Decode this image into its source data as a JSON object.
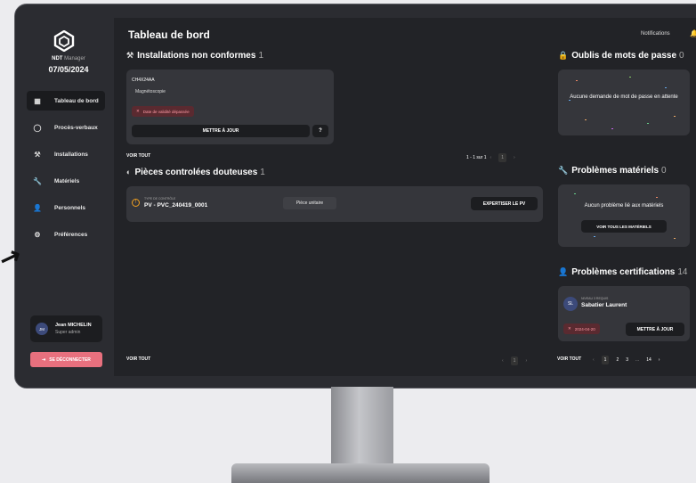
{
  "app": {
    "name_bold": "NDT",
    "name_rest": " Manager",
    "date": "07/05/2024"
  },
  "sidebar": {
    "items": [
      {
        "label": "Tableau de bord",
        "icon": "dashboard-icon"
      },
      {
        "label": "Procès-verbaux",
        "icon": "circle-icon"
      },
      {
        "label": "Installations",
        "icon": "installation-icon"
      },
      {
        "label": "Matériels",
        "icon": "wrench-icon"
      },
      {
        "label": "Personnels",
        "icon": "person-icon"
      },
      {
        "label": "Préférences",
        "icon": "gear-icon"
      }
    ],
    "user": {
      "initials": "JM",
      "name": "Jean MICHELIN",
      "role": "Super admin"
    },
    "logout": "SE DÉCONNECTER"
  },
  "header": {
    "title": "Tableau de bord",
    "notifications": "Notifications"
  },
  "installations": {
    "title": "Installations non conformes",
    "count": "1",
    "card": {
      "id": "CH4X24AA",
      "method": "Magnétoscopie",
      "alert": "Date de validité dépassée",
      "button": "METTRE À JOUR"
    },
    "see_all": "VOIR TOUT",
    "pagination": "1 - 1 sur 1",
    "page": "1"
  },
  "pieces": {
    "title": "Pièces controlées douteuses",
    "count": "1",
    "card": {
      "type_label": "TYPE DE CONTRÔLE",
      "name": "PV - PVC_240419_0001",
      "tag": "Pièce unitaire",
      "button": "EXPERTISER LE PV"
    },
    "see_all": "VOIR TOUT",
    "page": "1"
  },
  "passwords": {
    "title": "Oublis de mots de passe",
    "count": "0",
    "empty": "Aucune demande de mot de passe en attente"
  },
  "materials": {
    "title": "Problèmes matériels",
    "count": "0",
    "empty": "Aucun problème lié aux matériels",
    "button": "VOIR TOUS LES MATÉRIELS"
  },
  "certifications": {
    "title": "Problèmes certifications",
    "count": "14",
    "card": {
      "initials": "SL",
      "level": "NIVEAU 3 REQUIS",
      "name": "Sabatier Laurent",
      "date": "2024-04-20",
      "button": "METTRE À JOUR"
    },
    "see_all": "VOIR TOUT",
    "pages": [
      "1",
      "2",
      "3",
      "...",
      "14"
    ]
  },
  "colors": {
    "background": "#222327",
    "sidebar": "#2b2c31",
    "card": "#35363b",
    "danger": "#e8707e"
  }
}
